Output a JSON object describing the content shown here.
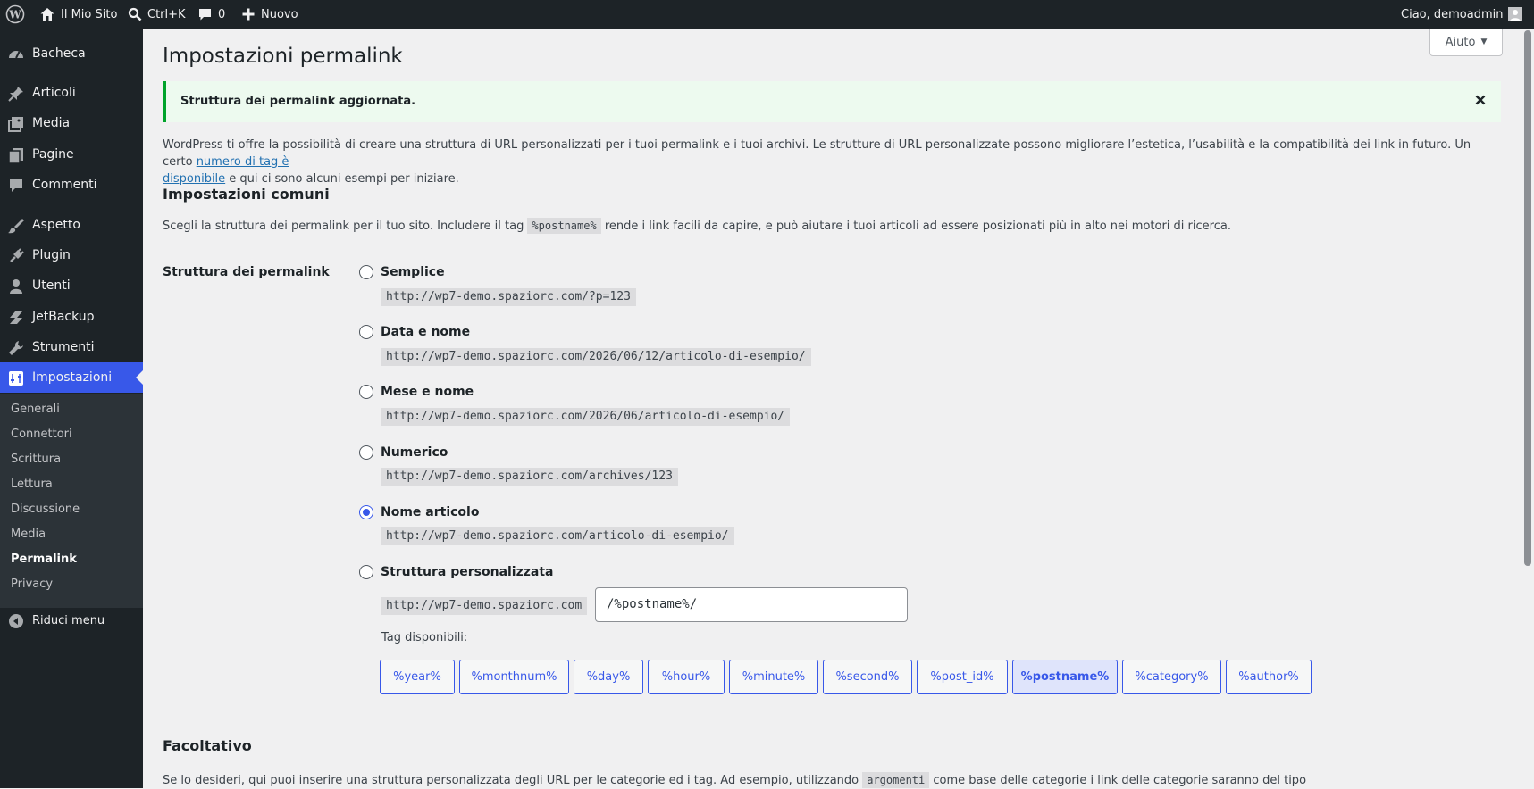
{
  "colors": {
    "adminbar_bg": "#1d2327",
    "accent": "#3858e9",
    "notice_border": "#00a32a"
  },
  "adminbar": {
    "site_name": "Il Mio Sito",
    "search_shortcut": "Ctrl+K",
    "comments_count": "0",
    "new_label": "Nuovo",
    "greeting": "Ciao, demoadmin"
  },
  "sidebar": {
    "items": [
      {
        "label": "Bacheca",
        "icon": "dashboard-icon"
      },
      {
        "label": "Articoli",
        "icon": "pin-icon"
      },
      {
        "label": "Media",
        "icon": "media-icon"
      },
      {
        "label": "Pagine",
        "icon": "page-icon"
      },
      {
        "label": "Commenti",
        "icon": "comment-icon"
      },
      {
        "label": "Aspetto",
        "icon": "brush-icon"
      },
      {
        "label": "Plugin",
        "icon": "plugin-icon"
      },
      {
        "label": "Utenti",
        "icon": "user-icon"
      },
      {
        "label": "JetBackup",
        "icon": "jetbackup-icon"
      },
      {
        "label": "Strumenti",
        "icon": "wrench-icon"
      },
      {
        "label": "Impostazioni",
        "icon": "settings-icon"
      }
    ],
    "submenu": [
      "Generali",
      "Connettori",
      "Scrittura",
      "Lettura",
      "Discussione",
      "Media",
      "Permalink",
      "Privacy"
    ],
    "collapse_label": "Riduci menu"
  },
  "help_label": "Aiuto",
  "page_title": "Impostazioni permalink",
  "notice": "Struttura dei permalink aggiornata.",
  "intro": {
    "text_before": "WordPress ti offre la possibilità di creare una struttura di URL personalizzati per i tuoi permalink e i tuoi archivi. Le strutture di URL personalizzate possono migliorare l’estetica, l’usabilità e la compatibilità dei link in futuro. Un certo ",
    "link_part1": "numero di tag è",
    "link_part2": "disponibile",
    "text_after": " e qui ci sono alcuni esempi per iniziare."
  },
  "common": {
    "heading": "Impostazioni comuni",
    "desc_before": "Scegli la struttura dei permalink per il tuo sito. Includere il tag ",
    "desc_tag": "%postname%",
    "desc_after": " rende i link facili da capire, e può aiutare i tuoi articoli ad essere posizionati più in alto nei motori di ricerca.",
    "structure_label": "Struttura dei permalink"
  },
  "options": [
    {
      "label": "Semplice",
      "example": "http://wp7-demo.spaziorc.com/?p=123",
      "checked": false
    },
    {
      "label": "Data e nome",
      "example": "http://wp7-demo.spaziorc.com/2026/06/12/articolo-di-esempio/",
      "checked": false
    },
    {
      "label": "Mese e nome",
      "example": "http://wp7-demo.spaziorc.com/2026/06/articolo-di-esempio/",
      "checked": false
    },
    {
      "label": "Numerico",
      "example": "http://wp7-demo.spaziorc.com/archives/123",
      "checked": false
    },
    {
      "label": "Nome articolo",
      "example": "http://wp7-demo.spaziorc.com/articolo-di-esempio/",
      "checked": true
    },
    {
      "label": "Struttura personalizzata",
      "example": "http://wp7-demo.spaziorc.com",
      "checked": false
    }
  ],
  "custom_value": "/%postname%/",
  "tags_label": "Tag disponibili:",
  "tags": [
    "%year%",
    "%monthnum%",
    "%day%",
    "%hour%",
    "%minute%",
    "%second%",
    "%post_id%",
    "%postname%",
    "%category%",
    "%author%"
  ],
  "active_tag": "%postname%",
  "optional": {
    "heading": "Facoltativo",
    "desc_before": "Se lo desideri, qui puoi inserire una struttura personalizzata degli URL per le categorie ed i tag. Ad esempio, utilizzando ",
    "desc_tag": "argomenti",
    "desc_after": " come base delle categorie i link delle categorie saranno del tipo"
  }
}
